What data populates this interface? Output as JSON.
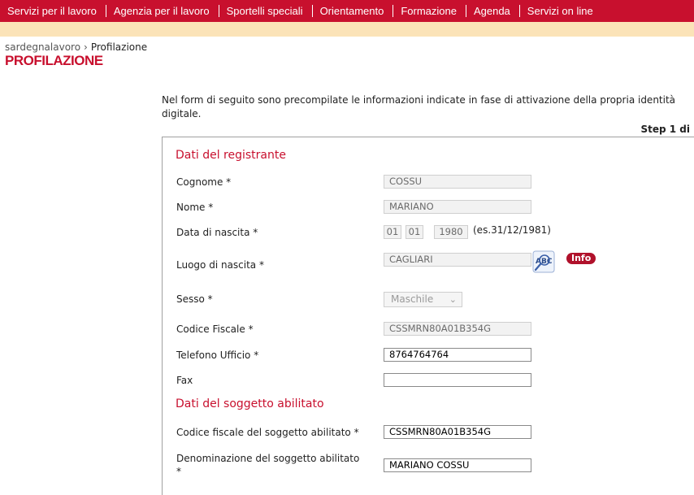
{
  "nav": {
    "items": [
      "Servizi per il lavoro",
      "Agenzia per il lavoro",
      "Sportelli speciali",
      "Orientamento",
      "Formazione",
      "Agenda",
      "Servizi on line"
    ]
  },
  "breadcrumb": {
    "home": "sardegnalavoro",
    "separator": "›",
    "current": "Profilazione"
  },
  "page_title": "PROFILAZIONE",
  "intro": {
    "line1": "Nel form di seguito sono precompilate le informazioni indicate in fase di attivazione della propria identità",
    "line2": "digitale."
  },
  "step": "Step 1 di",
  "section1": {
    "title": "Dati del registrante",
    "cognome_label": "Cognome *",
    "cognome_value": "COSSU",
    "nome_label": "Nome *",
    "nome_value": "MARIANO",
    "nascita_label": "Data di nascita *",
    "nascita_day": "01",
    "nascita_month": "01",
    "nascita_year": "1980",
    "nascita_hint": "(es.31/12/1981)",
    "luogo_label": "Luogo di nascita *",
    "luogo_value": "CAGLIARI",
    "info": "Info",
    "sesso_label": "Sesso *",
    "sesso_value": "Maschile",
    "cf_label": "Codice Fiscale *",
    "cf_value": "CSSMRN80A01B354G",
    "tel_label": "Telefono Ufficio *",
    "tel_value": "8764764764",
    "fax_label": "Fax",
    "fax_value": ""
  },
  "section2": {
    "title": "Dati del soggetto abilitato",
    "cf_label": "Codice fiscale del soggetto abilitato *",
    "cf_value": "CSSMRN80A01B354G",
    "den_label_line1": "Denominazione del soggetto abilitato",
    "den_label_line2": "*",
    "den_value": "MARIANO COSSU"
  },
  "colors": {
    "brand_red": "#c8102e",
    "subbar": "#fbe3b8",
    "info_badge": "#b0112b"
  },
  "icons": {
    "luogo_lookup": "abc-lookup-icon"
  }
}
